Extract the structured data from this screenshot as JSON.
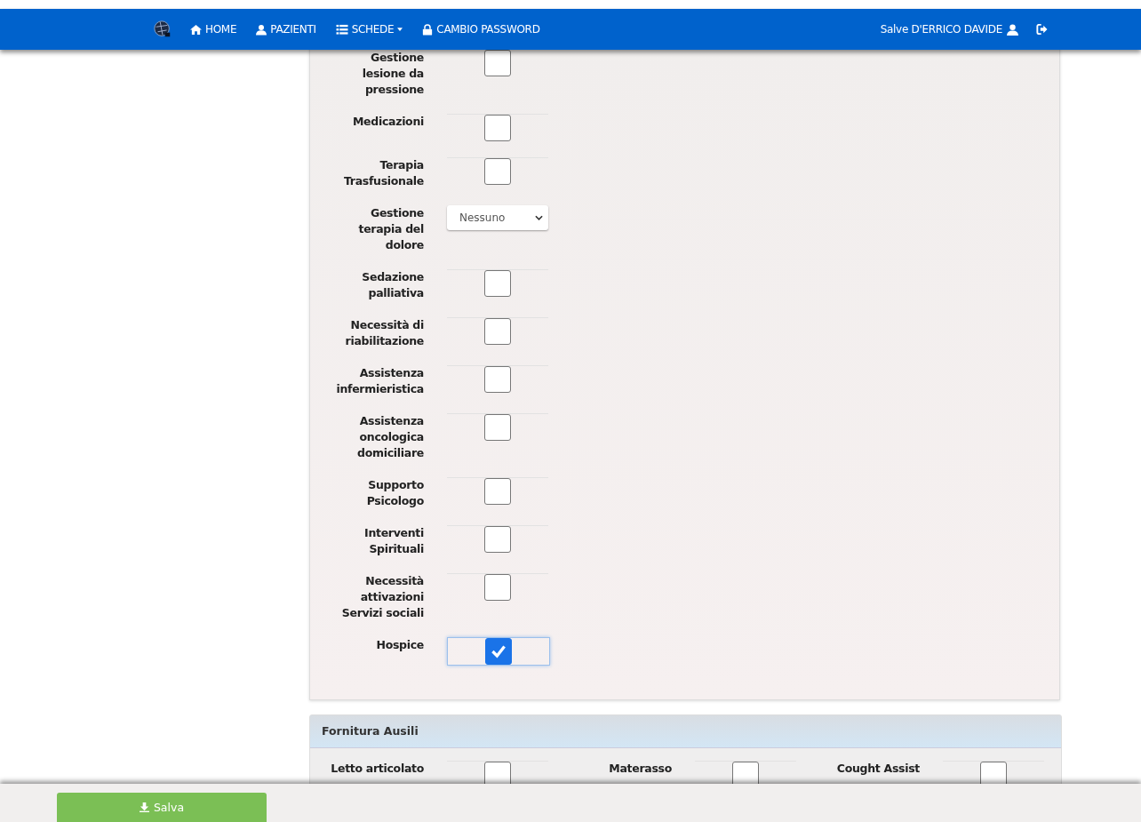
{
  "nav": {
    "items": [
      {
        "label": "HOME",
        "kind": "link"
      },
      {
        "label": "PAZIENTI",
        "kind": "link"
      },
      {
        "label": "SCHEDE",
        "kind": "dropdown"
      },
      {
        "label": "CAMBIO PASSWORD",
        "kind": "link"
      }
    ],
    "greeting": "Salve D'ERRICO DAVIDE"
  },
  "fields": [
    {
      "label": "Gestione lesione da pressione",
      "kind": "checkbox",
      "checked": false
    },
    {
      "label": "Medicazioni",
      "kind": "checkbox",
      "checked": false
    },
    {
      "label": "Terapia Trasfusionale",
      "kind": "checkbox",
      "checked": false
    },
    {
      "label": "Gestione terapia del dolore",
      "kind": "select",
      "value": "Nessuno"
    },
    {
      "label": "Sedazione palliativa",
      "kind": "checkbox",
      "checked": false
    },
    {
      "label": "Necessità di riabilitazione",
      "kind": "checkbox",
      "checked": false
    },
    {
      "label": "Assistenza infermieristica",
      "kind": "checkbox",
      "checked": false
    },
    {
      "label": "Assistenza oncologica domiciliare",
      "kind": "checkbox",
      "checked": false
    },
    {
      "label": "Supporto Psicologo",
      "kind": "checkbox",
      "checked": false
    },
    {
      "label": "Interventi Spirituali",
      "kind": "checkbox",
      "checked": false
    },
    {
      "label": "Necessità attivazioni Servizi sociali",
      "kind": "checkbox",
      "checked": false
    },
    {
      "label": "Hospice",
      "kind": "checkbox",
      "checked": true
    }
  ],
  "section": {
    "title": "Fornitura Ausili",
    "fields": [
      {
        "label": "Letto articolato",
        "checked": false
      },
      {
        "label": "Materasso",
        "checked": false
      },
      {
        "label": "Cought Assist",
        "checked": false
      }
    ]
  },
  "save_button": "Salva"
}
